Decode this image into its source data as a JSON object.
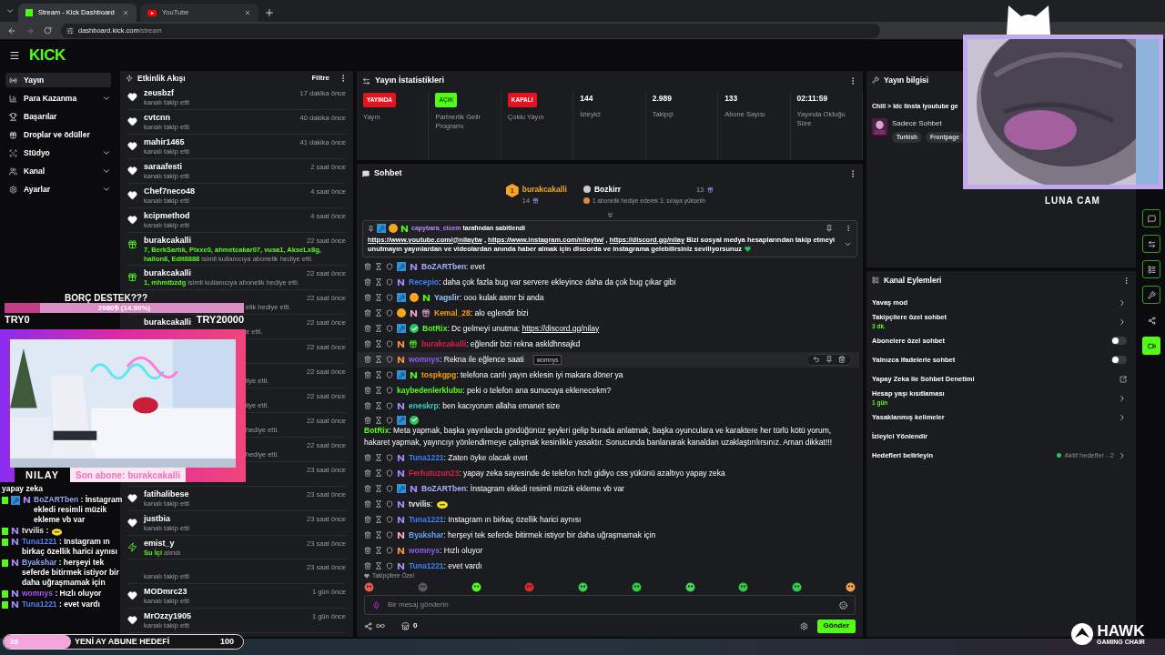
{
  "browser": {
    "tabs": [
      {
        "title": "Stream - Kick Dashboard",
        "kind": "kick",
        "selected": true
      },
      {
        "title": "YouTube",
        "kind": "youtube",
        "selected": false
      }
    ],
    "url_host": "dashboard.kick.com",
    "url_path": "/stream"
  },
  "logo": "KICK",
  "sidebar": [
    {
      "label": "Yayın",
      "expandable": false,
      "selected": true
    },
    {
      "label": "Para Kazanma",
      "expandable": true,
      "selected": false
    },
    {
      "label": "Başarılar",
      "expandable": false,
      "selected": false
    },
    {
      "label": "Droplar ve ödüller",
      "expandable": false,
      "selected": false
    },
    {
      "label": "Stüdyo",
      "expandable": true,
      "selected": false
    },
    {
      "label": "Kanal",
      "expandable": true,
      "selected": false
    },
    {
      "label": "Ayarlar",
      "expandable": true,
      "selected": false
    }
  ],
  "event_feed": {
    "title": "Etkinlik Akışı",
    "filter": "Filtre",
    "items": [
      {
        "kind": "follow",
        "name": "zeusbzf",
        "text": "kanalı takip etti",
        "time": "17 dakika önce"
      },
      {
        "kind": "follow",
        "name": "cvtcnn",
        "text": "kanalı takip etti",
        "time": "40 dakika önce"
      },
      {
        "kind": "follow",
        "name": "mahir1465",
        "text": "kanalı takip etti",
        "time": "41 dakika önce"
      },
      {
        "kind": "follow",
        "name": "saraafesti",
        "text": "kanalı takip etti",
        "time": "2 saat önce"
      },
      {
        "kind": "follow",
        "name": "Chef7neco48",
        "text": "kanalı takip etti",
        "time": "4 saat önce"
      },
      {
        "kind": "follow",
        "name": "kcipmethod",
        "text": "kanalı takip etti",
        "time": "4 saat önce"
      },
      {
        "kind": "gift",
        "name": "burakcakalli",
        "highlight": "7, BerkSartık, Pixxe0, ahmetcakar07, vusa1, AkseLx8g, hallon8, Edit8888",
        "text": " isimli kullanıcıya abonelik hediye etti.",
        "time": "22 saat önce"
      },
      {
        "kind": "gift",
        "name": "burakcakalli",
        "highlight": "1, mhmtbzdg",
        "text": " isimli kullanıcıya abonelik hediye etti.",
        "time": "22 saat önce"
      },
      {
        "kind": "covered",
        "text": "elik hediye etti.",
        "time": "22 saat önce"
      },
      {
        "kind": "covered",
        "name": "burakcakalli",
        "text": "e etti.",
        "time": "22 saat önce"
      },
      {
        "kind": "covered",
        "time": "22 saat önce"
      },
      {
        "kind": "covered",
        "text": "liye etti.",
        "time": "22 saat önce"
      },
      {
        "kind": "covered",
        "text": "liye etti.",
        "time": "22 saat önce"
      },
      {
        "kind": "covered",
        "text": "hediye etti.",
        "time": "22 saat önce"
      },
      {
        "kind": "covered",
        "text": "hediye etti.",
        "time": "22 saat önce"
      },
      {
        "kind": "covered",
        "time": "23 saat önce"
      },
      {
        "kind": "follow",
        "name": "fatihalibese",
        "text": "kanalı takip etti",
        "time": "23 saat önce"
      },
      {
        "kind": "follow",
        "name": "justbia",
        "text": "kanalı takip etti",
        "time": "23 saat önce"
      },
      {
        "kind": "reward",
        "name": "emist_y",
        "highlight": "Su İçi",
        "text": " alındı",
        "time": "23 saat önce"
      },
      {
        "kind": "nameless",
        "text": "kanalı takip etti",
        "time": "23 saat önce"
      },
      {
        "kind": "follow",
        "name": "MODmrc23",
        "text": "kanalı takip etti",
        "time": "1 gün önce"
      },
      {
        "kind": "follow",
        "name": "MrOzzy1905",
        "text": "kanalı takip etti",
        "time": "1 gün önce"
      }
    ]
  },
  "stats": {
    "title": "Yayın İstatistikleri",
    "items": [
      {
        "kind": "badge",
        "value": "YAYINDA",
        "color": "#e3141f",
        "label": "Yayın"
      },
      {
        "kind": "badge",
        "value": "AÇIK",
        "color": "#53fc18",
        "label": "Partnerlik Gelir Programı"
      },
      {
        "kind": "badge",
        "value": "KAPALI",
        "color": "#e3141f",
        "label": "Çoklu Yayın"
      },
      {
        "kind": "number",
        "value": "144",
        "label": "İzleyici"
      },
      {
        "kind": "number",
        "value": "2.989",
        "label": "Takipçi"
      },
      {
        "kind": "number",
        "value": "133",
        "label": "Abone Sayısı"
      },
      {
        "kind": "number",
        "value": "02:11:59",
        "label": "Yayında Olduğu Süre"
      }
    ]
  },
  "chat": {
    "title": "Sohbet",
    "leader_first": {
      "rank": "1",
      "name": "burakcakalli",
      "count": "14"
    },
    "leader_second": {
      "name": "Bozkirr",
      "count": "13"
    },
    "leader_hint": "1 abonelik hediye ederek 3. sıraya yükselin",
    "pinned": {
      "by": "capybara_cicem",
      "suffix": " tarafından sabitlendi",
      "content": [
        {
          "kind": "link",
          "text": "https://www.youtube.com/@nilaytw"
        },
        {
          "kind": "text",
          "text": " , "
        },
        {
          "kind": "link",
          "text": "https://www.instagram.com/nilaytw/"
        },
        {
          "kind": "text",
          "text": " , "
        },
        {
          "kind": "link",
          "text": "https://discord.gg/nilay"
        },
        {
          "kind": "text",
          "text": " Bizi sosyal medya hesaplarından takip etmeyi unutmayın yayınlardan ve videolardan anında haber almak için discorda ve instagrama gelebilirsiniz seviliyorsunuz"
        }
      ]
    },
    "messages": [
      {
        "badges": [
          {
            "kind": "mod"
          },
          {
            "kind": "sub"
          }
        ],
        "name": "BoZARTben",
        "color": "#a5b4fc",
        "kind": "text",
        "text": ": evet",
        "hovered": false
      },
      {
        "badges": [
          {
            "kind": "sub"
          }
        ],
        "name": "Recepio",
        "color": "#3b82f6",
        "kind": "text",
        "text": ": daha çok fazla bug var servere ekleyince daha da çok bug çıkar gibi",
        "hovered": false
      },
      {
        "badges": [
          {
            "kind": "mod"
          },
          {
            "kind": "coin"
          },
          {
            "kind": "sub-green"
          }
        ],
        "name": "Yagslir",
        "color": "#93c5fd",
        "kind": "text",
        "text": ": ooo kulak asmr bi anda",
        "hovered": false
      },
      {
        "badges": [
          {
            "kind": "coin"
          },
          {
            "kind": "sub-pink"
          },
          {
            "kind": "gift-pink"
          }
        ],
        "name": "Kemal_28",
        "color": "#f59e0b",
        "kind": "text",
        "text": ": alo eglendir bizi",
        "hovered": false
      },
      {
        "badges": [
          {
            "kind": "mod"
          },
          {
            "kind": "verified"
          }
        ],
        "name": "BotRix",
        "color": "#53fc18",
        "kind": "link",
        "text": ": Dc gelmeyi unutma: ",
        "link": "https://discord.gg/nilay",
        "hovered": false
      },
      {
        "badges": [
          {
            "kind": "sub-orange"
          },
          {
            "kind": "gift"
          }
        ],
        "name": "burakcakalli",
        "color": "#e11d48",
        "kind": "text",
        "text": ": eğlendir bizi rekna askldhnsajkd",
        "hovered": false
      },
      {
        "badges": [
          {
            "kind": "sub-orange"
          }
        ],
        "name": "womnys",
        "color": "#8b5cf6",
        "kind": "text",
        "text": ": Rekna ile eğlence saati",
        "hovered": true,
        "tooltip": "womnys"
      },
      {
        "badges": [
          {
            "kind": "mod"
          },
          {
            "kind": "sub-green"
          }
        ],
        "name": "tospkgpg",
        "color": "#f59e0b",
        "kind": "text",
        "text": ": telefona canlı yayın eklesin iyi makara döner ya",
        "hovered": false
      },
      {
        "name": "kaybedenlerklubu",
        "color": "#53fc18",
        "kind": "text",
        "text": ": peki o telefon ana sunucuya eklenecekm?",
        "hovered": false
      },
      {
        "badges": [
          {
            "kind": "sub"
          }
        ],
        "name": "eneskrp",
        "color": "#2dd4bf",
        "kind": "text",
        "text": ": ben kacıyorum allaha emanet size",
        "hovered": false
      },
      {
        "badges": [
          {
            "kind": "mod"
          },
          {
            "kind": "verified"
          }
        ],
        "name": "BotRix",
        "color": "#53fc18",
        "kind": "text",
        "text": ": Meta yapmak, başka yayınlarda gördüğünüz şeyleri gelip burada anlatmak, başka oyunculara ve karaktere her türlü kötü yorum, hakaret yapmak, yayıncıyı yönlendirmeye çalışmak kesinlikle yasaktır. Sonucunda banlanarak kanaldan uzaklaştırılırsınız. Aman dikkat!!!",
        "hovered": false
      },
      {
        "badges": [
          {
            "kind": "sub"
          }
        ],
        "name": "Tuna1221",
        "color": "#3b82f6",
        "kind": "text",
        "text": ": Zaten öyke olacak evet",
        "hovered": false
      },
      {
        "badges": [
          {
            "kind": "sub"
          }
        ],
        "name": "Ferhatuzun23",
        "color": "#e11d48",
        "kind": "text",
        "text": ": yapay zeka sayesinde de telefon hızlı gidiyo css yükünü azaltıyo yapay zeka",
        "hovered": false
      },
      {
        "badges": [
          {
            "kind": "mod"
          },
          {
            "kind": "sub"
          }
        ],
        "name": "BoZARTben",
        "color": "#a5b4fc",
        "kind": "text",
        "text": ": İnstagram ekledi resimli müzik ekleme vb var",
        "hovered": false
      },
      {
        "badges": [
          {
            "kind": "sub"
          }
        ],
        "name": "tvvilis",
        "color": "#e5e7eb",
        "kind": "emote",
        "text": ":",
        "hovered": false
      },
      {
        "badges": [
          {
            "kind": "sub"
          }
        ],
        "name": "Tuna1221",
        "color": "#3b82f6",
        "kind": "text",
        "text": ": Instagram ın birkaç özellik harici aynısı",
        "hovered": false
      },
      {
        "badges": [
          {
            "kind": "sub-pink"
          }
        ],
        "name": "Byakshar",
        "color": "#60a5fa",
        "kind": "text",
        "text": ": herşeyi tek seferde bitirmek istiyor bir daha uğraşmamak için",
        "hovered": false
      },
      {
        "badges": [
          {
            "kind": "sub-orange"
          }
        ],
        "name": "womnys",
        "color": "#8b5cf6",
        "kind": "text",
        "text": ": Hızlı oluyor",
        "hovered": false
      },
      {
        "badges": [
          {
            "kind": "sub"
          }
        ],
        "name": "Tuna1221",
        "color": "#3b82f6",
        "kind": "text",
        "text": ": evet vardı",
        "hovered": false
      }
    ],
    "section": "Takipçilere Özel",
    "placeholder": "Bir mesaj gönderin",
    "points": "0",
    "send": "Gönder"
  },
  "stream_info": {
    "title": "Yayın bilgisi",
    "stream_title": "Chill > Idc linsta lyoutube ge",
    "category": "Sadece Sohbet",
    "tags": [
      "Turkish",
      "Frontpage"
    ]
  },
  "channel_actions": {
    "title": "Kanal Eylemleri",
    "items": [
      {
        "kind": "chevron",
        "label": "Yavaş mod"
      },
      {
        "kind": "chevron",
        "label": "Takipçilere özel sohbet",
        "sub": "3 dk."
      },
      {
        "kind": "toggle",
        "label": "Abonelere özel sohbet",
        "on": false
      },
      {
        "kind": "toggle",
        "label": "Yalnızca ifadelerle sohbet",
        "on": false
      },
      {
        "kind": "external",
        "label": "Yapay Zeka ile Sohbet Denetimi"
      },
      {
        "kind": "chevron",
        "label": "Hesap yaşı kısıtlaması",
        "sub": "1 gün"
      },
      {
        "kind": "chevron",
        "label": "Yasaklanmış kelimeler"
      },
      {
        "kind": "plain",
        "label": "İzleyici Yönlendir"
      },
      {
        "kind": "chevron",
        "label": "Hedefleri belirleyin",
        "status": "Aktif hedefler - 2"
      }
    ]
  },
  "rail": [
    {
      "selected": false
    },
    {
      "selected": false
    },
    {
      "selected": false
    },
    {
      "selected": false
    },
    {
      "selected": false
    },
    {
      "selected": true
    }
  ],
  "overlay": {
    "goal": {
      "title": "BORÇ DESTEK???",
      "reading": "2980₺ (14.90%)",
      "level": 0.149,
      "min": "TRY0",
      "max": "TRY20000"
    },
    "cam_name": "NILAY",
    "last_sub": "Son abone: burakcakalli",
    "chat": [
      {
        "kind": "continuation",
        "text": "yapay zeka"
      },
      {
        "kind": "message",
        "mod": true,
        "name": "BoZARTben",
        "color": "#93a5f5",
        "text": ": İnstagram ekledi resimli müzik ekleme vb var"
      },
      {
        "kind": "emote",
        "mod": false,
        "name": "tvvilis",
        "color": "#e5e7eb",
        "text": ":"
      },
      {
        "kind": "message",
        "mod": false,
        "name": "Tuna1221",
        "color": "#4f86f7",
        "text": ": Instagram ın birkaç özellik harici aynısı"
      },
      {
        "kind": "message",
        "mod": false,
        "name": "Byakshar",
        "color": "#93a5f5",
        "text": ": herşeyi tek seferde bitirmek istiyor bir daha uğraşmamak için"
      },
      {
        "kind": "message",
        "mod": false,
        "name": "womnys",
        "color": "#a855f7",
        "text": ": Hızlı oluyor"
      },
      {
        "kind": "message",
        "mod": false,
        "name": "Tuna1221",
        "color": "#4f86f7",
        "text": ": evet vardı"
      }
    ],
    "sub_goal": {
      "count": "28",
      "title": "YENİ AY ABUNE HEDEFİ",
      "target": "100",
      "level": 0.28
    },
    "cat_cam": "LUNA CAM",
    "sponsor": "HAWK",
    "sponsor_sub": "GAMING CHAIR"
  }
}
